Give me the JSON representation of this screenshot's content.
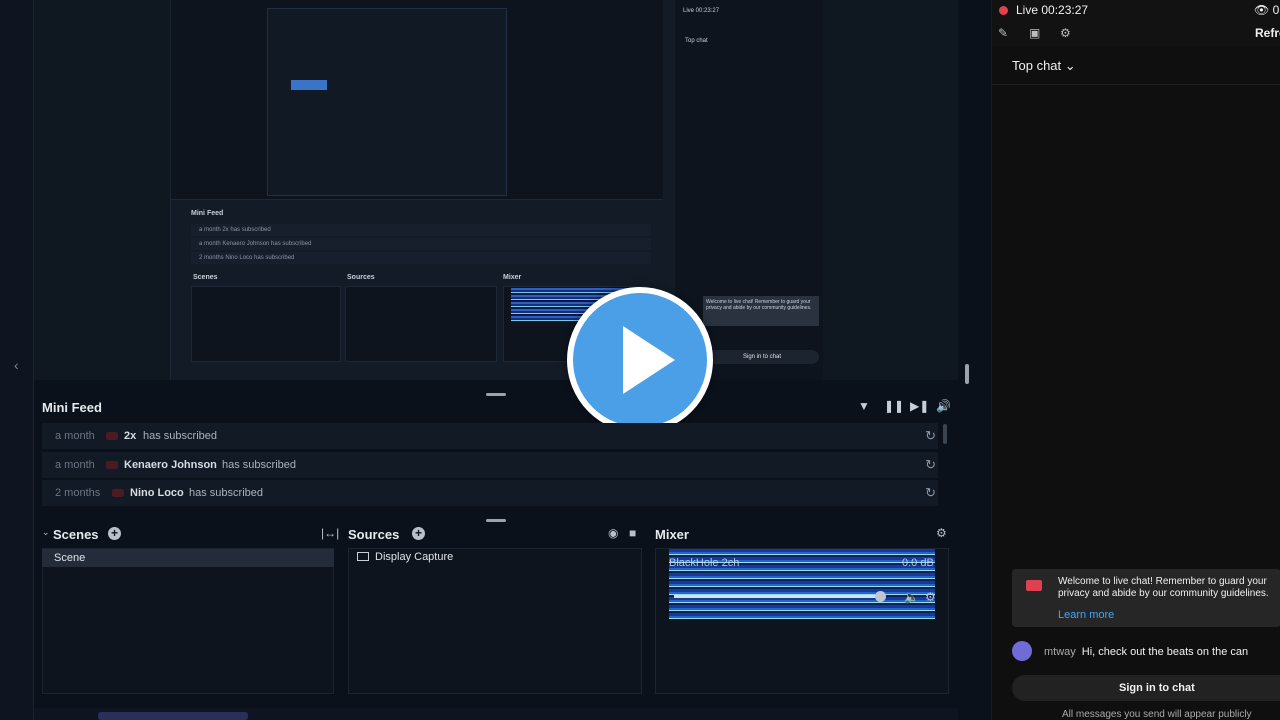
{
  "preview": {
    "nested": {
      "mini_feed_title": "Mini Feed",
      "rows": [
        "a month  2x  has subscribed",
        "a month  Kenaero Johnson  has subscribed",
        "2 months  Nino Loco  has subscribed"
      ],
      "scenes": "Scenes",
      "sources": "Sources",
      "mixer": "Mixer",
      "live": "Live 00:23:27",
      "top_chat": "Top chat",
      "welcome": "Welcome to live chat! Remember to guard your privacy and abide by our community guidelines.",
      "sign_in": "Sign in to chat"
    }
  },
  "mini_feed": {
    "title": "Mini Feed",
    "items": [
      {
        "time": "a month",
        "name": "2x",
        "action": "has subscribed"
      },
      {
        "time": "a month",
        "name": "Kenaero Johnson",
        "action": "has subscribed"
      },
      {
        "time": "2 months",
        "name": "Nino Loco",
        "action": "has subscribed"
      }
    ],
    "controls": [
      "filter-icon",
      "pause-icon",
      "skip-icon",
      "volume-icon"
    ]
  },
  "docks": {
    "scenes": {
      "title": "Scenes",
      "items": [
        "Scene"
      ]
    },
    "sources": {
      "title": "Sources",
      "items": [
        "Display Capture"
      ]
    },
    "mixer": {
      "title": "Mixer",
      "track": "BlackHole 2ch",
      "db": "0.0 dB"
    }
  },
  "chat": {
    "live_label": "Live",
    "timer": "00:23:27",
    "viewers": "0",
    "refresh": "Refre",
    "mode": "Top chat",
    "welcome": "Welcome to live chat! Remember to guard your privacy and abide by our community guidelines.",
    "learn_more": "Learn more",
    "message": {
      "author": "mtway",
      "text": "Hi, check out the beats on the can"
    },
    "sign_in": "Sign in to chat",
    "note": "All messages you send will appear publicly"
  },
  "colors": {
    "accent": "#4a9fe6",
    "live": "#e0414e",
    "link": "#3ea6ff"
  }
}
